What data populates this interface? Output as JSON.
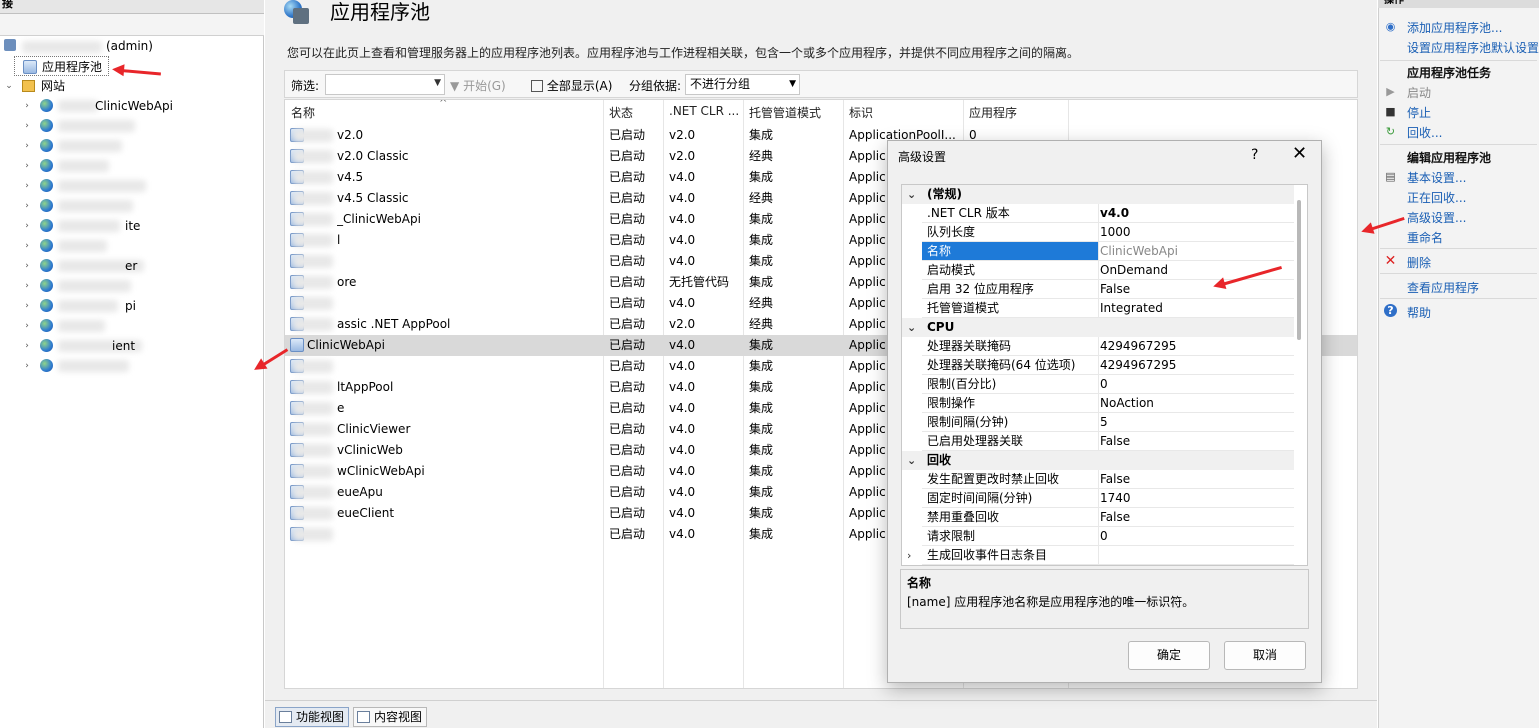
{
  "left": {
    "header": "接",
    "server_label": "(admin)",
    "app_pools_label": "应用程序池",
    "sites_label": "网站",
    "sites": [
      {
        "label": "ClinicWebApi"
      },
      {
        "label": ""
      },
      {
        "label": ""
      },
      {
        "label": ""
      },
      {
        "label": ""
      },
      {
        "label": ""
      },
      {
        "label": "ite"
      },
      {
        "label": ""
      },
      {
        "label": "er"
      },
      {
        "label": ""
      },
      {
        "label": "pi"
      },
      {
        "label": ""
      },
      {
        "label": "ient"
      },
      {
        "label": ""
      }
    ]
  },
  "center": {
    "title": "应用程序池",
    "description": "您可以在此页上查看和管理服务器上的应用程序池列表。应用程序池与工作进程相关联，包含一个或多个应用程序，并提供不同应用程序之间的隔离。",
    "filter": {
      "label": "筛选:",
      "go_label": "开始(G)",
      "show_all_label": "全部显示(A)",
      "group_by_label": "分组依据:",
      "group_by_value": "不进行分组"
    },
    "columns": [
      "名称",
      "状态",
      ".NET CLR ...",
      "托管管道模式",
      "标识",
      "应用程序"
    ],
    "rows": [
      {
        "name": "v2.0",
        "status": "已启动",
        "clr": "v2.0",
        "mode": "集成",
        "identity": "ApplicationPoolI...",
        "apps": "0"
      },
      {
        "name": "v2.0 Classic",
        "status": "已启动",
        "clr": "v2.0",
        "mode": "经典",
        "identity": "Applic",
        "apps": ""
      },
      {
        "name": "v4.5",
        "status": "已启动",
        "clr": "v4.0",
        "mode": "集成",
        "identity": "Applic",
        "apps": ""
      },
      {
        "name": "v4.5 Classic",
        "status": "已启动",
        "clr": "v4.0",
        "mode": "经典",
        "identity": "Applic",
        "apps": ""
      },
      {
        "name": "_ClinicWebApi",
        "status": "已启动",
        "clr": "v4.0",
        "mode": "集成",
        "identity": "Applic",
        "apps": ""
      },
      {
        "name": "l",
        "status": "已启动",
        "clr": "v4.0",
        "mode": "集成",
        "identity": "Applic",
        "apps": ""
      },
      {
        "name": "",
        "status": "已启动",
        "clr": "v4.0",
        "mode": "集成",
        "identity": "Applic",
        "apps": ""
      },
      {
        "name": "ore",
        "status": "已启动",
        "clr": "无托管代码",
        "mode": "集成",
        "identity": "Applic",
        "apps": ""
      },
      {
        "name": "",
        "status": "已启动",
        "clr": "v4.0",
        "mode": "经典",
        "identity": "Applic",
        "apps": ""
      },
      {
        "name": "assic .NET AppPool",
        "status": "已启动",
        "clr": "v2.0",
        "mode": "经典",
        "identity": "Applic",
        "apps": ""
      },
      {
        "name": "ClinicWebApi",
        "status": "已启动",
        "clr": "v4.0",
        "mode": "集成",
        "identity": "Applic",
        "apps": "",
        "selected": true
      },
      {
        "name": "",
        "status": "已启动",
        "clr": "v4.0",
        "mode": "集成",
        "identity": "Applic",
        "apps": ""
      },
      {
        "name": "ltAppPool",
        "status": "已启动",
        "clr": "v4.0",
        "mode": "集成",
        "identity": "Applic",
        "apps": ""
      },
      {
        "name": "e",
        "status": "已启动",
        "clr": "v4.0",
        "mode": "集成",
        "identity": "Applic",
        "apps": ""
      },
      {
        "name": "ClinicViewer",
        "status": "已启动",
        "clr": "v4.0",
        "mode": "集成",
        "identity": "Applic",
        "apps": ""
      },
      {
        "name": "vClinicWeb",
        "status": "已启动",
        "clr": "v4.0",
        "mode": "集成",
        "identity": "Applic",
        "apps": ""
      },
      {
        "name": "wClinicWebApi",
        "status": "已启动",
        "clr": "v4.0",
        "mode": "集成",
        "identity": "Applic",
        "apps": ""
      },
      {
        "name": "eueApu",
        "status": "已启动",
        "clr": "v4.0",
        "mode": "集成",
        "identity": "Applic",
        "apps": ""
      },
      {
        "name": "eueClient",
        "status": "已启动",
        "clr": "v4.0",
        "mode": "集成",
        "identity": "Applic",
        "apps": ""
      },
      {
        "name": "",
        "status": "已启动",
        "clr": "v4.0",
        "mode": "集成",
        "identity": "Applic",
        "apps": ""
      }
    ],
    "tabs": {
      "features_view": "功能视图",
      "content_view": "内容视图"
    }
  },
  "actions": {
    "header": "操作",
    "add_pool": "添加应用程序池...",
    "set_defaults": "设置应用程序池默认设置...",
    "tasks_header": "应用程序池任务",
    "start": "启动",
    "stop": "停止",
    "recycle": "回收...",
    "edit_header": "编辑应用程序池",
    "basic_settings": "基本设置...",
    "recycling": "正在回收...",
    "advanced_settings": "高级设置...",
    "rename": "重命名",
    "delete": "删除",
    "view_apps": "查看应用程序",
    "help": "帮助"
  },
  "dialog": {
    "title": "高级设置",
    "help_glyph": "?",
    "close_glyph": "✕",
    "properties": [
      {
        "type": "cat",
        "name": "(常规)",
        "expanded": true
      },
      {
        "type": "prop",
        "name": ".NET CLR 版本",
        "value": "v4.0",
        "bold": true
      },
      {
        "type": "prop",
        "name": "队列长度",
        "value": "1000"
      },
      {
        "type": "prop",
        "name": "名称",
        "value": "ClinicWebApi",
        "selected": true
      },
      {
        "type": "prop",
        "name": "启动模式",
        "value": "OnDemand"
      },
      {
        "type": "prop",
        "name": "启用 32 位应用程序",
        "value": "False"
      },
      {
        "type": "prop",
        "name": "托管管道模式",
        "value": "Integrated"
      },
      {
        "type": "cat",
        "name": "CPU",
        "expanded": true
      },
      {
        "type": "prop",
        "name": "处理器关联掩码",
        "value": "4294967295"
      },
      {
        "type": "prop",
        "name": "处理器关联掩码(64 位选项)",
        "value": "4294967295"
      },
      {
        "type": "prop",
        "name": "限制(百分比)",
        "value": "0"
      },
      {
        "type": "prop",
        "name": "限制操作",
        "value": "NoAction"
      },
      {
        "type": "prop",
        "name": "限制间隔(分钟)",
        "value": "5"
      },
      {
        "type": "prop",
        "name": "已启用处理器关联",
        "value": "False"
      },
      {
        "type": "cat",
        "name": "回收",
        "expanded": true
      },
      {
        "type": "prop",
        "name": "发生配置更改时禁止回收",
        "value": "False"
      },
      {
        "type": "prop",
        "name": "固定时间间隔(分钟)",
        "value": "1740"
      },
      {
        "type": "prop",
        "name": "禁用重叠回收",
        "value": "False"
      },
      {
        "type": "prop",
        "name": "请求限制",
        "value": "0"
      },
      {
        "type": "sub",
        "name": "生成回收事件日志条目",
        "value": ""
      }
    ],
    "desc_title": "名称",
    "desc_text": "[name] 应用程序池名称是应用程序池的唯一标识符。",
    "ok_label": "确定",
    "cancel_label": "取消"
  },
  "colors": {
    "arrow": "#e8262a",
    "link": "#1a5fb4",
    "selection": "#1e7ad8"
  }
}
